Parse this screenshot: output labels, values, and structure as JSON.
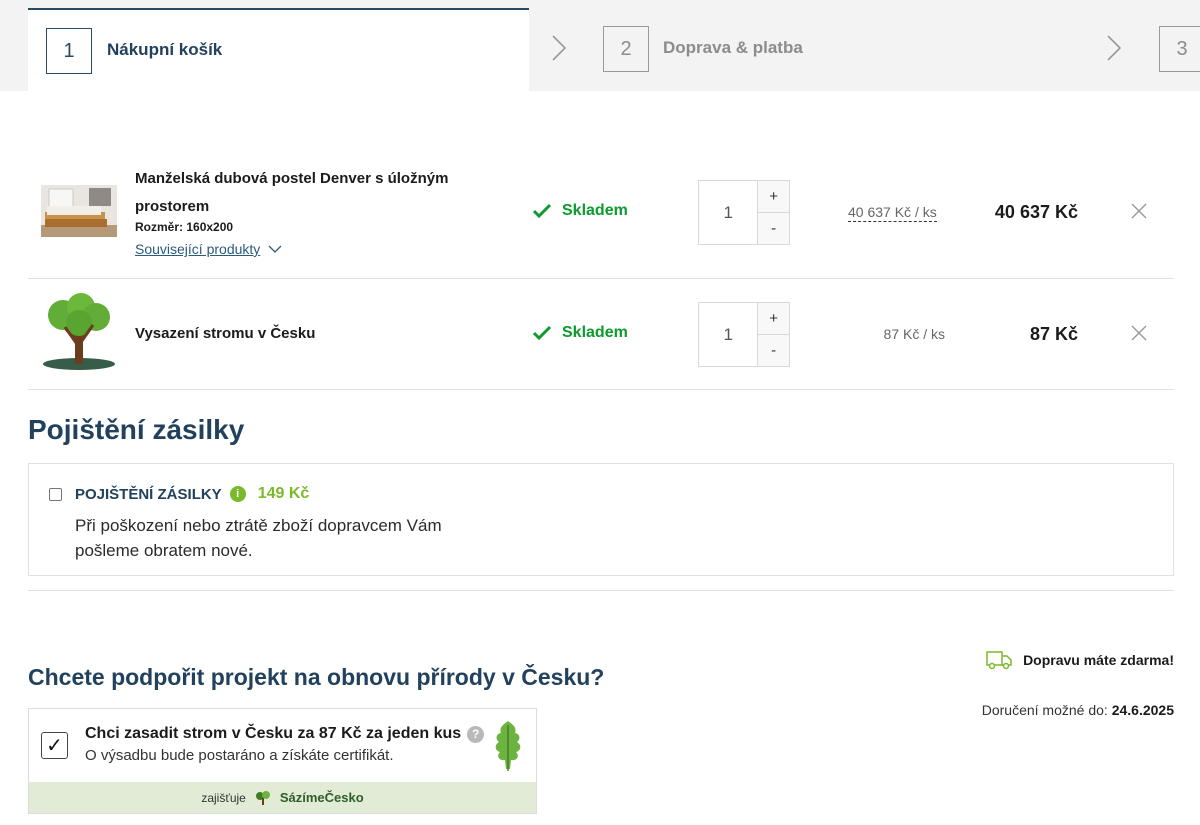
{
  "steps": [
    {
      "number": "1",
      "label": "Nákupní košík"
    },
    {
      "number": "2",
      "label": "Doprava & platba"
    },
    {
      "number": "3",
      "label": ""
    }
  ],
  "cart": {
    "items": [
      {
        "name": "Manželská dubová postel Denver s úložným prostorem",
        "size": "Rozměr: 160x200",
        "related": "Související produkty",
        "stock": "Skladem",
        "qty": "1",
        "unit_price": "40 637 Kč / ks",
        "total": "40 637 Kč",
        "image_icon": "bed-photo"
      },
      {
        "name": "Vysazení stromu v Česku",
        "stock": "Skladem",
        "qty": "1",
        "unit_price": "87 Kč / ks",
        "total": "87 Kč",
        "image_icon": "tree-illustration"
      }
    ],
    "plus": "+",
    "minus": "-"
  },
  "insurance": {
    "section_title": "Pojištění zásilky",
    "title": "POJIŠTĚNÍ ZÁSILKY",
    "info_glyph": "i",
    "price": "149 Kč",
    "description": "Při poškození nebo ztrátě zboží dopravcem Vám pošleme obratem nové."
  },
  "project": {
    "title": "Chcete podpořit projekt na obnovu přírody v Česku?",
    "checkbox_label": "Chci zasadit strom v Česku za 87 Kč za jeden kus",
    "checkbox_mark": "✓",
    "help_glyph": "?",
    "sub": "O výsadbu bude postaráno a získáte certifikát.",
    "footer_prefix": "zajišťuje",
    "footer_brand": "SázímeČesko"
  },
  "delivery": {
    "free": "Dopravu máte zdarma!",
    "date_prefix": "Doručení možné do:",
    "date": "24.6.2025"
  },
  "colors": {
    "primary": "#21415c",
    "stock_green": "#0c9b2d",
    "price_green": "#7ab929"
  }
}
